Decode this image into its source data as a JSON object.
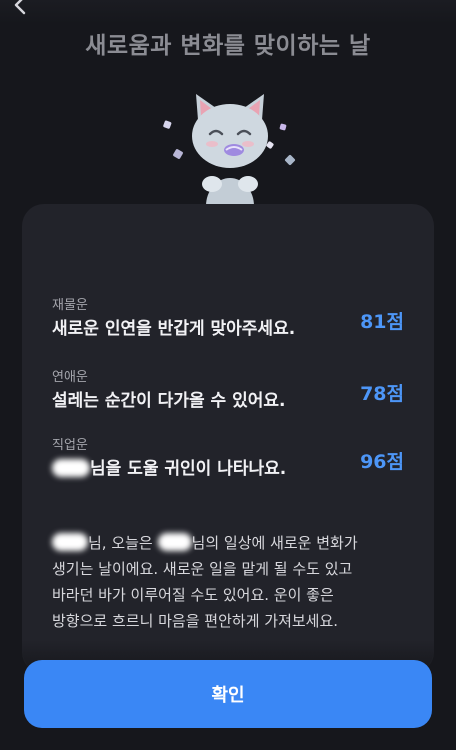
{
  "header": {
    "title": "새로움과 변화를 맞이하는 날"
  },
  "fortunes": [
    {
      "category": "재물운",
      "message": "새로운 인연을 반갑게 맞아주세요.",
      "score": "81점"
    },
    {
      "category": "연애운",
      "message": "설레는 순간이 다가올 수 있어요.",
      "score": "78점"
    },
    {
      "category": "직업운",
      "message": "님을 도울 귀인이 나타나요.",
      "score": "96점"
    }
  ],
  "summary": {
    "line1_a": "님, 오늘은",
    "line1_b": "님의 일상에 새로운 변화가",
    "line2": "생기는 날이에요. 새로운 일을 맡게 될 수도 있고",
    "line3": "바라던 바가 이루어질 수도 있어요. 운이 좋은",
    "line4": "방향으로 흐르니 마음을 편안하게 가져보세요."
  },
  "footer": {
    "confirm_label": "확인"
  },
  "colors": {
    "background": "#16171c",
    "card": "#22232a",
    "accent": "#3a87f5",
    "score": "#4d96f7"
  },
  "icons": {
    "back": "back-arrow-icon",
    "mascot": "cat-mascot-illustration"
  }
}
